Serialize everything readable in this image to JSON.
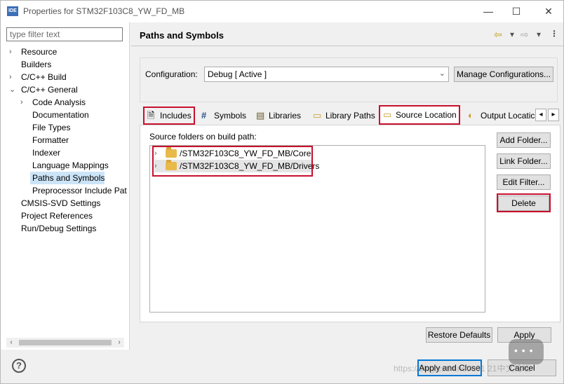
{
  "window": {
    "app_icon_text": "IDE",
    "title": "Properties for STM32F103C8_YW_FD_MB",
    "minimize": "—",
    "maximize": "☐",
    "close": "✕"
  },
  "left_panel": {
    "filter_placeholder": "type filter text",
    "tree": [
      {
        "label": "Resource",
        "expander": "›"
      },
      {
        "label": "Builders",
        "expander": ""
      },
      {
        "label": "C/C++ Build",
        "expander": "›"
      },
      {
        "label": "C/C++ General",
        "expander": "⌄"
      },
      {
        "label": "Code Analysis",
        "expander": "›"
      },
      {
        "label": "Documentation",
        "expander": ""
      },
      {
        "label": "File Types",
        "expander": ""
      },
      {
        "label": "Formatter",
        "expander": ""
      },
      {
        "label": "Indexer",
        "expander": ""
      },
      {
        "label": "Language Mappings",
        "expander": ""
      },
      {
        "label": "Paths and Symbols",
        "expander": "",
        "selected": true
      },
      {
        "label": "Preprocessor Include Pat",
        "expander": ""
      },
      {
        "label": "CMSIS-SVD Settings",
        "expander": ""
      },
      {
        "label": "Project References",
        "expander": ""
      },
      {
        "label": "Run/Debug Settings",
        "expander": ""
      }
    ],
    "scroll_left": "‹",
    "scroll_right": "›"
  },
  "page": {
    "title": "Paths and Symbols",
    "nav_back": "⇦",
    "nav_back_menu": "▾",
    "nav_forward": "⇨",
    "nav_forward_menu": "▾",
    "view_menu": "⋮"
  },
  "configuration": {
    "label": "Configuration:",
    "selected": "Debug  [ Active ]",
    "manage_button": "Manage Configurations..."
  },
  "tabs": [
    {
      "label": "Includes",
      "icon": "includes-icon",
      "glyph": "🗎"
    },
    {
      "label": "Symbols",
      "icon": "hash-icon",
      "glyph": "#"
    },
    {
      "label": "Libraries",
      "icon": "libraries-icon",
      "glyph": "▤"
    },
    {
      "label": "Library Paths",
      "icon": "folder-icon",
      "glyph": "▭"
    },
    {
      "label": "Source Location",
      "icon": "folder-open-icon",
      "glyph": "▭",
      "active": true
    },
    {
      "label": "Output Locatic",
      "icon": "output-icon",
      "glyph": "◐"
    }
  ],
  "tab_scroll": {
    "left": "◂",
    "right": "▸"
  },
  "source_location": {
    "label": "Source folders on build path:",
    "folders": [
      "/STM32F103C8_YW_FD_MB/Core",
      "/STM32F103C8_YW_FD_MB/Drivers"
    ],
    "buttons": {
      "add_folder": "Add Folder...",
      "link_folder": "Link Folder...",
      "edit_filter": "Edit Filter...",
      "delete": "Delete"
    }
  },
  "footer": {
    "restore_defaults": "Restore Defaults",
    "apply": "Apply",
    "apply_and_close": "Apply and Close",
    "cancel": "Cancel",
    "help": "?"
  },
  "watermark": "https://blog.csdn.net/u01  21中文论坛",
  "colors": {
    "highlight_box": "#c8102e",
    "selection": "#cce4f7",
    "folder": "#e9b94a"
  }
}
